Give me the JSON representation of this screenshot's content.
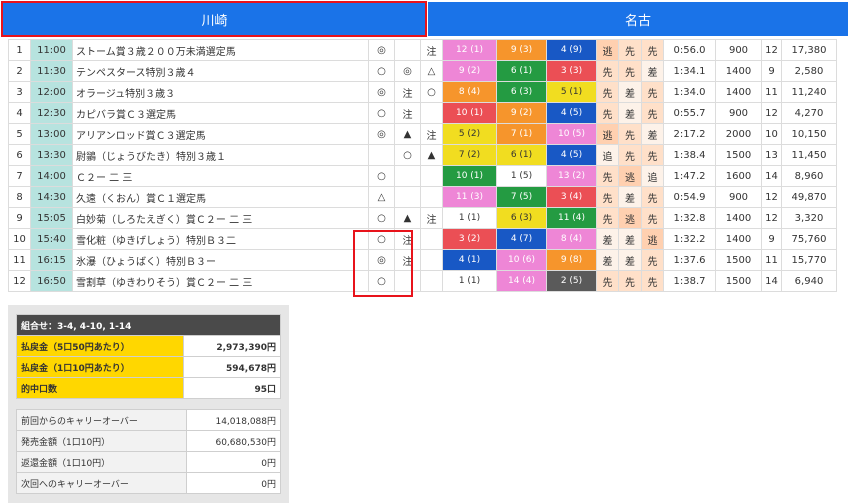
{
  "tabs": {
    "left": "川崎",
    "right": "名古"
  },
  "colors": {
    "tab_blue": "#1a73e8",
    "highlight_red": "#e8131b",
    "time_teal": "#b7e3df",
    "pink": "#ee86d6",
    "orange": "#f6952c",
    "blue": "#1858c5",
    "red": "#eb4f55",
    "yellow": "#f1dd20",
    "green": "#249b42",
    "gray": "#5a5a5a",
    "summary_yellow": "#ffd700"
  },
  "races": [
    {
      "no": "1",
      "time": "11:00",
      "name": "ストーム賞３歳２００万未満選定馬",
      "m1": "◎",
      "m2": "",
      "m3": "注",
      "b1": "12 (1)",
      "b2": "9 (3)",
      "b3": "4 (9)",
      "k1": "逃",
      "k2": "先",
      "k3": "先",
      "t": "0:56.0",
      "d": "900",
      "h": "12",
      "p": "17,380"
    },
    {
      "no": "2",
      "time": "11:30",
      "name": "テンペスタース特別３歳４",
      "m1": "○",
      "m2": "◎",
      "m3": "△",
      "b1": "9 (2)",
      "b2": "6 (1)",
      "b3": "3 (3)",
      "k1": "先",
      "k2": "先",
      "k3": "差",
      "t": "1:34.1",
      "d": "1400",
      "h": "9",
      "p": "2,580"
    },
    {
      "no": "3",
      "time": "12:00",
      "name": "オラージュ特別３歳３",
      "m1": "◎",
      "m2": "注",
      "m3": "○",
      "b1": "8 (4)",
      "b2": "6 (3)",
      "b3": "5 (1)",
      "k1": "先",
      "k2": "差",
      "k3": "先",
      "t": "1:34.0",
      "d": "1400",
      "h": "11",
      "p": "11,240"
    },
    {
      "no": "4",
      "time": "12:30",
      "name": "カピバラ賞Ｃ３選定馬",
      "m1": "○",
      "m2": "注",
      "m3": "",
      "b1": "10 (1)",
      "b2": "9 (2)",
      "b3": "4 (5)",
      "k1": "先",
      "k2": "差",
      "k3": "先",
      "t": "0:55.7",
      "d": "900",
      "h": "12",
      "p": "4,270"
    },
    {
      "no": "5",
      "time": "13:00",
      "name": "アリアンロッド賞Ｃ３選定馬",
      "m1": "◎",
      "m2": "▲",
      "m3": "注",
      "b1": "5 (2)",
      "b2": "7 (1)",
      "b3": "10 (5)",
      "k1": "逃",
      "k2": "先",
      "k3": "差",
      "t": "2:17.2",
      "d": "2000",
      "h": "10",
      "p": "10,150"
    },
    {
      "no": "6",
      "time": "13:30",
      "name": "尉鶲（じょうびたき）特別３歳１",
      "m1": "",
      "m2": "○",
      "m3": "▲",
      "b1": "7 (2)",
      "b2": "6 (1)",
      "b3": "4 (5)",
      "k1": "追",
      "k2": "先",
      "k3": "先",
      "t": "1:38.4",
      "d": "1500",
      "h": "13",
      "p": "11,450"
    },
    {
      "no": "7",
      "time": "14:00",
      "name": "Ｃ２ー 二 三",
      "m1": "○",
      "m2": "",
      "m3": "",
      "b1": "10 (1)",
      "b2": "1 (5)",
      "b3": "13 (2)",
      "k1": "先",
      "k2": "逃",
      "k3": "追",
      "t": "1:47.2",
      "d": "1600",
      "h": "14",
      "p": "8,960"
    },
    {
      "no": "8",
      "time": "14:30",
      "name": "久遠（くおん）賞Ｃ１選定馬",
      "m1": "△",
      "m2": "",
      "m3": "",
      "b1": "11 (3)",
      "b2": "7 (5)",
      "b3": "3 (4)",
      "k1": "先",
      "k2": "差",
      "k3": "先",
      "t": "0:54.9",
      "d": "900",
      "h": "12",
      "p": "49,870"
    },
    {
      "no": "9",
      "time": "15:05",
      "name": "白妙菊（しろたえぎく）賞Ｃ２ー 二 三",
      "m1": "○",
      "m2": "▲",
      "m3": "注",
      "b1": "1 (1)",
      "b2": "6 (3)",
      "b3": "11 (4)",
      "k1": "先",
      "k2": "逃",
      "k3": "先",
      "t": "1:32.8",
      "d": "1400",
      "h": "12",
      "p": "3,320"
    },
    {
      "no": "10",
      "time": "15:40",
      "name": "雪化粧（ゆきげしょう）特別Ｂ３二",
      "m1": "○",
      "m2": "注",
      "m3": "",
      "b1": "3 (2)",
      "b2": "4 (7)",
      "b3": "8 (4)",
      "k1": "差",
      "k2": "差",
      "k3": "逃",
      "t": "1:32.2",
      "d": "1400",
      "h": "9",
      "p": "75,760"
    },
    {
      "no": "11",
      "time": "16:15",
      "name": "氷瀑（ひょうばく）特別Ｂ３ー",
      "m1": "◎",
      "m2": "注",
      "m3": "",
      "b1": "4 (1)",
      "b2": "10 (6)",
      "b3": "9 (8)",
      "k1": "差",
      "k2": "差",
      "k3": "先",
      "t": "1:37.6",
      "d": "1500",
      "h": "11",
      "p": "15,770"
    },
    {
      "no": "12",
      "time": "16:50",
      "name": "雪割草（ゆきわりそう）賞Ｃ２ー 二 三",
      "m1": "○",
      "m2": "",
      "m3": "",
      "b1": "1 (1)",
      "b2": "14 (4)",
      "b3": "2 (5)",
      "k1": "先",
      "k2": "先",
      "k3": "先",
      "t": "1:38.7",
      "d": "1500",
      "h": "14",
      "p": "6,940"
    }
  ],
  "summary": {
    "combo": "組合せ：3-4, 4-10, 1-14",
    "payout1_label": "払戻金（5口50円あたり）",
    "payout1_value": "2,973,390円",
    "payout2_label": "払戻金（1口10円あたり）",
    "payout2_value": "594,678円",
    "hits_label": "的中口数",
    "hits_value": "95口",
    "carry_prev_label": "前回からのキャリーオーバー",
    "carry_prev_value": "14,018,088円",
    "sales_label": "発売金額（1口10円）",
    "sales_value": "60,680,530円",
    "refund_label": "返還金額（1口10円）",
    "refund_value": "0円",
    "carry_next_label": "次回へのキャリーオーバー",
    "carry_next_value": "0円"
  }
}
